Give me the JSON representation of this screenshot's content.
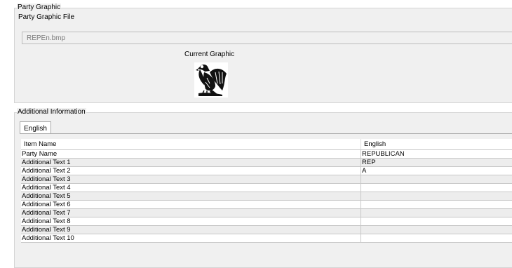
{
  "party_graphic": {
    "legend": "Party Graphic",
    "file_label": "Party Graphic File",
    "file_value": "REPEn.bmp",
    "current_label": "Current Graphic"
  },
  "additional_info": {
    "legend": "Additional Information",
    "tab_label": "English",
    "columns": [
      "Item Name",
      "English"
    ],
    "rows": [
      [
        "Party Name",
        "REPUBLICAN"
      ],
      [
        "Additional Text 1",
        "REP"
      ],
      [
        "Additional Text 2",
        "A"
      ],
      [
        "Additional Text 3",
        ""
      ],
      [
        "Additional Text 4",
        ""
      ],
      [
        "Additional Text 5",
        ""
      ],
      [
        "Additional Text 6",
        ""
      ],
      [
        "Additional Text 7",
        ""
      ],
      [
        "Additional Text 8",
        ""
      ],
      [
        "Additional Text 9",
        ""
      ],
      [
        "Additional Text 10",
        ""
      ]
    ]
  }
}
